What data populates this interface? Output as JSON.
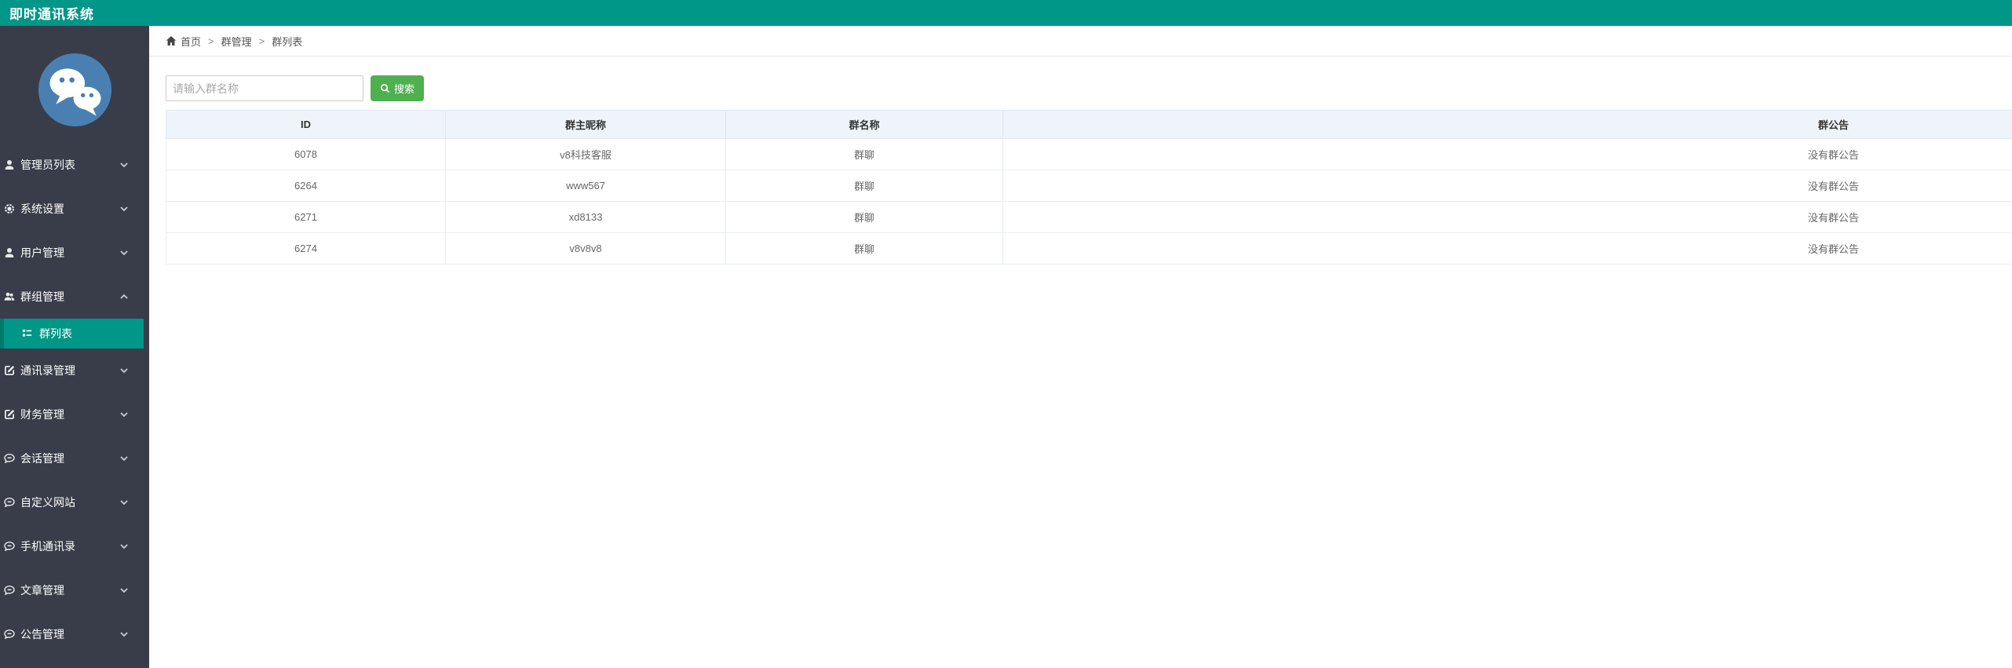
{
  "topbar": {
    "title": "即时通讯系统",
    "color": "#009688"
  },
  "sidebar": {
    "bg_color": "#393D49",
    "active_color": "#009688",
    "logo_icon": "wechat-logo-icon",
    "logo_color": "#4a80b1",
    "items": [
      {
        "label": "管理员列表",
        "icon": "user-icon",
        "state": "collapsed"
      },
      {
        "label": "系统设置",
        "icon": "gear-icon",
        "state": "collapsed"
      },
      {
        "label": "用户管理",
        "icon": "user-icon",
        "state": "collapsed"
      },
      {
        "label": "群组管理",
        "icon": "users-icon",
        "state": "expanded",
        "children": [
          {
            "label": "群列表",
            "icon": "list-icon",
            "active": true
          }
        ]
      },
      {
        "label": "通讯录管理",
        "icon": "edit-icon",
        "state": "collapsed"
      },
      {
        "label": "财务管理",
        "icon": "edit-icon",
        "state": "collapsed"
      },
      {
        "label": "会话管理",
        "icon": "comment-icon",
        "state": "collapsed"
      },
      {
        "label": "自定义网站",
        "icon": "comment-icon",
        "state": "collapsed"
      },
      {
        "label": "手机通讯录",
        "icon": "comment-icon",
        "state": "collapsed"
      },
      {
        "label": "文章管理",
        "icon": "comment-icon",
        "state": "collapsed"
      },
      {
        "label": "公告管理",
        "icon": "comment-icon",
        "state": "collapsed"
      }
    ]
  },
  "breadcrumb": {
    "home_icon": "home-icon",
    "separator": ">",
    "items": [
      "首页",
      "群管理",
      "群列表"
    ]
  },
  "search": {
    "placeholder": "请输入群名称",
    "value": "",
    "button_label": "搜索",
    "button_icon": "search-icon",
    "button_color": "#4FB050"
  },
  "table": {
    "headers": [
      "ID",
      "群主昵称",
      "群名称",
      "群公告"
    ],
    "rows": [
      {
        "id": "6078",
        "owner": "v8科技客服",
        "name": "群聊",
        "notice": "没有群公告"
      },
      {
        "id": "6264",
        "owner": "www567",
        "name": "群聊",
        "notice": "没有群公告"
      },
      {
        "id": "6271",
        "owner": "xd8133",
        "name": "群聊",
        "notice": "没有群公告"
      },
      {
        "id": "6274",
        "owner": "v8v8v8",
        "name": "群聊",
        "notice": "没有群公告"
      }
    ]
  }
}
